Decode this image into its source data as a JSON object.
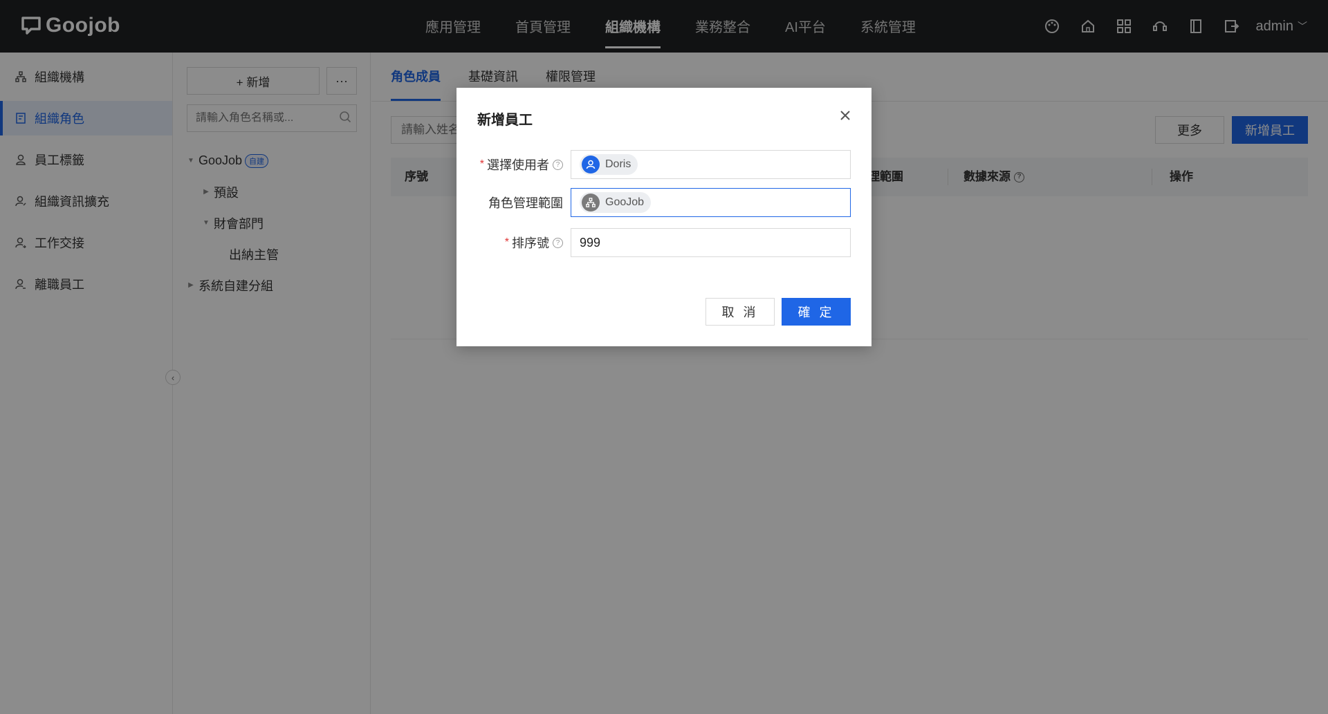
{
  "app": {
    "logo_text": "Goojob"
  },
  "topnav": {
    "items": [
      "應用管理",
      "首頁管理",
      "組織機構",
      "業務整合",
      "AI平台",
      "系統管理"
    ],
    "active": "組織機構"
  },
  "top_icons": [
    "palette-icon",
    "home-icon",
    "apps-grid-icon",
    "support-headset-icon",
    "book-icon",
    "export-icon"
  ],
  "user": {
    "name": "admin"
  },
  "sidebar": {
    "items": [
      {
        "label": "組織機構",
        "icon": "org-icon"
      },
      {
        "label": "組織角色",
        "icon": "role-icon",
        "active": true
      },
      {
        "label": "員工標籤",
        "icon": "tag-user-icon"
      },
      {
        "label": "組織資訊擴充",
        "icon": "user-edit-icon"
      },
      {
        "label": "工作交接",
        "icon": "handover-icon"
      },
      {
        "label": "離職員工",
        "icon": "user-leave-icon"
      }
    ]
  },
  "treepanel": {
    "add_label": "+ 新增",
    "more_label": "···",
    "search_placeholder": "請輸入角色名稱或...",
    "tree": [
      {
        "label": "GooJob",
        "badge": "自建",
        "expanded": true,
        "level": 0
      },
      {
        "label": "預設",
        "expanded": false,
        "level": 1
      },
      {
        "label": "財會部門",
        "expanded": true,
        "level": 1
      },
      {
        "label": "出納主管",
        "level": 2
      },
      {
        "label": "系統自建分組",
        "expanded": false,
        "level": 0
      }
    ]
  },
  "main": {
    "tabs": [
      "角色成員",
      "基礎資訊",
      "權限管理"
    ],
    "active_tab": "角色成員",
    "search_placeholder": "請輸入姓名",
    "more_label": "更多",
    "add_label": "新增員工",
    "table_headers": [
      "序號",
      "理範圍",
      "數據來源",
      "操作"
    ]
  },
  "modal": {
    "title": "新增員工",
    "fields": [
      {
        "label": "選擇使用者",
        "required": true,
        "help": true,
        "chip": "Doris"
      },
      {
        "label": "角色管理範圍",
        "required": false,
        "help": false,
        "chip": "GooJob"
      },
      {
        "label": "排序號",
        "required": true,
        "help": true,
        "value": "999"
      }
    ],
    "cancel_label": "取 消",
    "ok_label": "確 定"
  },
  "colors": {
    "accent": "#1f66e6",
    "topbar": "#1f2124",
    "required": "#e03434"
  }
}
